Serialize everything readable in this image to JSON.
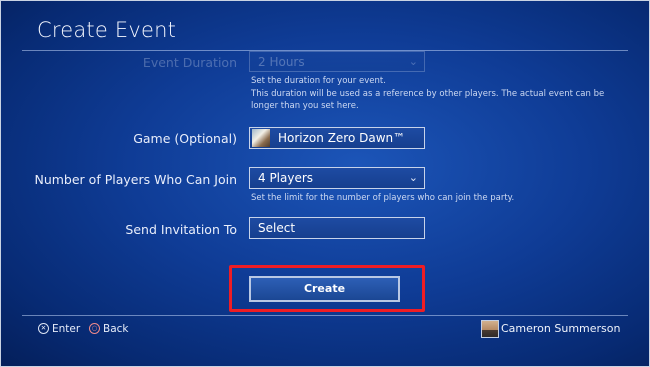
{
  "header": {
    "title": "Create Event"
  },
  "form": {
    "event_duration": {
      "label": "Event Duration",
      "value": "2 Hours",
      "desc_line1": "Set the duration for your event.",
      "desc_line2": "This duration will be used as a reference by other players. The actual event can be",
      "desc_line3": "longer than you set here."
    },
    "game": {
      "label": "Game (Optional)",
      "value": "Horizon Zero Dawn™"
    },
    "players": {
      "label": "Number of Players Who Can Join",
      "value": "4 Players",
      "desc": "Set the limit for the number of players who can join the party."
    },
    "invite": {
      "label": "Send Invitation To",
      "value": "Select"
    }
  },
  "actions": {
    "create_label": "Create"
  },
  "footer": {
    "enter_label": "Enter",
    "back_label": "Back",
    "cross_glyph": "✕",
    "circle_glyph": "○",
    "username": "Cameron Summerson"
  },
  "colors": {
    "highlight": "#ef1d24",
    "background": "#0f3c96"
  }
}
